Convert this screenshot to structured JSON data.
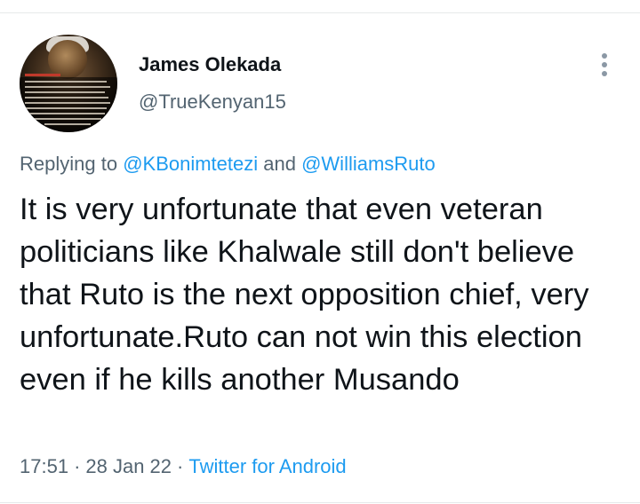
{
  "tweet": {
    "author": {
      "name": "James Olekada",
      "handle": "@TrueKenyan15"
    },
    "replying_prefix": "Replying to ",
    "reply_to": [
      "@KBonimtetezi",
      "@WilliamsRuto"
    ],
    "reply_connector": " and ",
    "text": "It is very unfortunate that even veteran politicians like Khalwale still don't believe that Ruto is the next opposition chief, very unfortunate.Ruto can not win this election even if he kills another Musando",
    "time": "17:51",
    "date": "28 Jan 22",
    "separator": "·",
    "source": "Twitter for Android"
  },
  "icons": {
    "more": "more-vertical-icon"
  },
  "colors": {
    "link": "#1d9bf0",
    "secondary_text": "#536471",
    "primary_text": "#0f1419"
  }
}
